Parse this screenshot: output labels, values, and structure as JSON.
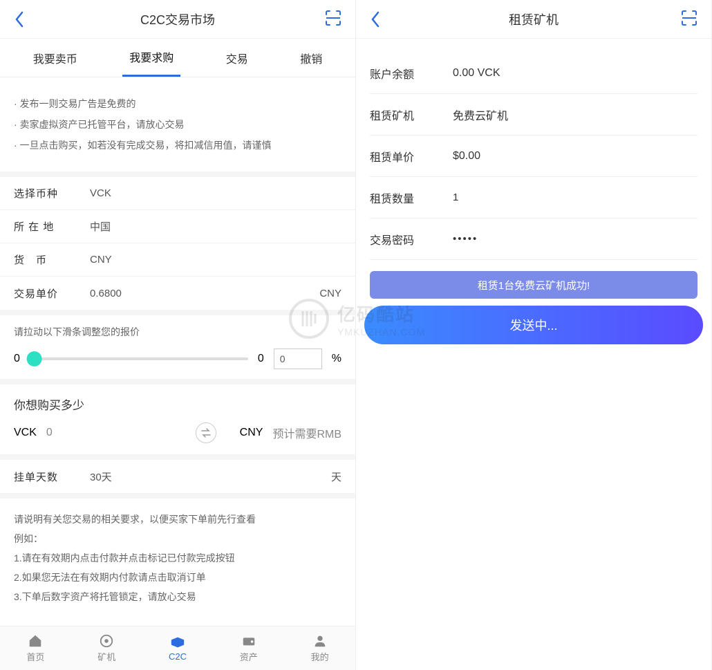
{
  "left": {
    "title": "C2C交易市场",
    "tabs": [
      "我要卖币",
      "我要求购",
      "交易",
      "撤销"
    ],
    "active_tab_index": 1,
    "info": [
      "· 发布一则交易广告是免费的",
      "· 卖家虚拟资产已托管平台，请放心交易",
      "· 一旦点击购买，如若没有完成交易，将扣减信用值，请谨慎"
    ],
    "fields": {
      "coin_label": "选择币种",
      "coin_value": "VCK",
      "location_label": "所 在 地",
      "location_value": "中国",
      "currency_label": "货　币",
      "currency_value": "CNY",
      "price_label": "交易单价",
      "price_value": "0.6800",
      "price_suffix": "CNY"
    },
    "slider": {
      "hint": "请拉动以下滑条调整您的报价",
      "min": "0",
      "max": "0",
      "pct_value": "0",
      "pct_suffix": "%"
    },
    "buy": {
      "title": "你想购买多少",
      "left_unit": "VCK",
      "left_value": "0",
      "right_unit": "CNY",
      "right_hint": "预计需要RMB"
    },
    "days": {
      "label": "挂单天数",
      "value": "30天",
      "suffix": "天"
    },
    "notes": [
      "请说明有关您交易的相关要求，以便买家下单前先行查看",
      "例如：",
      "1.请在有效期内点击付款并点击标记已付款完成按钮",
      "2.如果您无法在有效期内付款请点击取消订单",
      "3.下单后数字资产将托管锁定，请放心交易"
    ],
    "tabbar": [
      {
        "label": "首页",
        "icon": "home-icon"
      },
      {
        "label": "矿机",
        "icon": "miner-icon"
      },
      {
        "label": "C2C",
        "icon": "c2c-icon"
      },
      {
        "label": "资产",
        "icon": "asset-icon"
      },
      {
        "label": "我的",
        "icon": "profile-icon"
      }
    ],
    "tabbar_active_index": 2
  },
  "right": {
    "title": "租赁矿机",
    "rows": {
      "balance_label": "账户余额",
      "balance_value": "0.00 VCK",
      "machine_label": "租赁矿机",
      "machine_value": "免费云矿机",
      "price_label": "租赁单价",
      "price_value": "$0.00",
      "qty_label": "租赁数量",
      "qty_value": "1",
      "pwd_label": "交易密码",
      "pwd_value": "•••••"
    },
    "toast": "租赁1台免费云矿机成功!",
    "button": "发送中..."
  },
  "watermark": {
    "cn": "亿码酷站",
    "en": "YMKUZHAN.COM"
  }
}
